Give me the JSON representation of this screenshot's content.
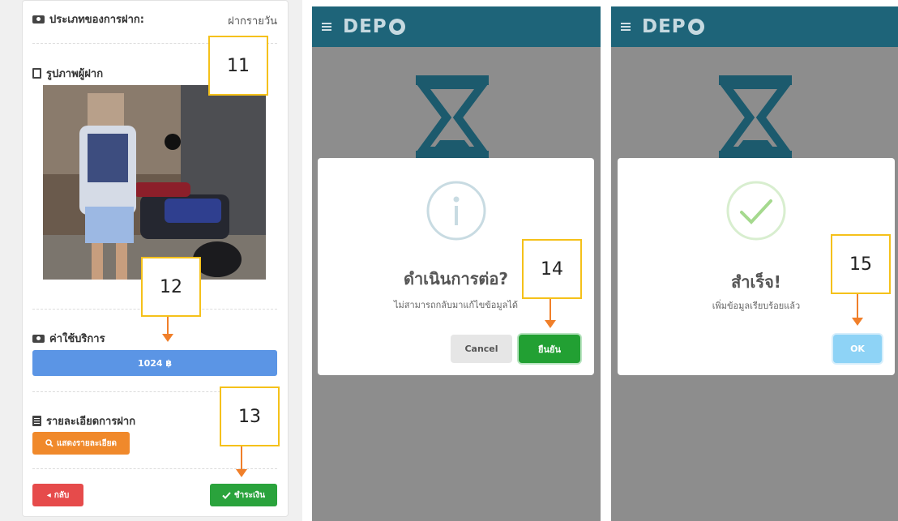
{
  "panel1": {
    "deposit_type_label": "ประเภทของการฝาก:",
    "deposit_type_value": "ฝากรายวัน",
    "photo_label": "รูปภาพผู้ฝาก",
    "fee_label": "ค่าใช้บริการ",
    "fee_value": "1024 ฿",
    "details_label": "รายละเอียดการฝาก",
    "show_details_button": "แสดงรายละเอียด",
    "back_button": "กลับ",
    "pay_button": "ชำระเงิน"
  },
  "app": {
    "logo_text": "DEP"
  },
  "confirm_dialog": {
    "title": "ดำเนินการต่อ?",
    "message": "ไม่สามารถกลับมาแก้ไขข้อมูลได้",
    "cancel_button": "Cancel",
    "confirm_button": "ยืนยัน"
  },
  "success_dialog": {
    "title": "สำเร็จ!",
    "message": "เพิ่มข้อมูลเรียบร้อยแล้ว",
    "ok_button": "OK"
  },
  "callouts": [
    "11",
    "12",
    "13",
    "14",
    "15"
  ],
  "colors": {
    "appbar": "#1e6479",
    "overlay": "#8d8d8d",
    "fee_bar": "#5b95e5",
    "orange_button": "#f0892b",
    "back_button": "#e64b4b",
    "pay_button": "#2aa33c",
    "confirm_button": "#22a033",
    "ok_button": "#8ed3f6",
    "callout_border": "#f5c11a",
    "arrow": "#f07f2a"
  },
  "icons": [
    "money-icon",
    "image-icon",
    "list-icon",
    "search-icon",
    "check-icon",
    "chevron-left-icon",
    "hamburger-icon",
    "hourglass-icon",
    "info-icon",
    "success-check-icon"
  ]
}
